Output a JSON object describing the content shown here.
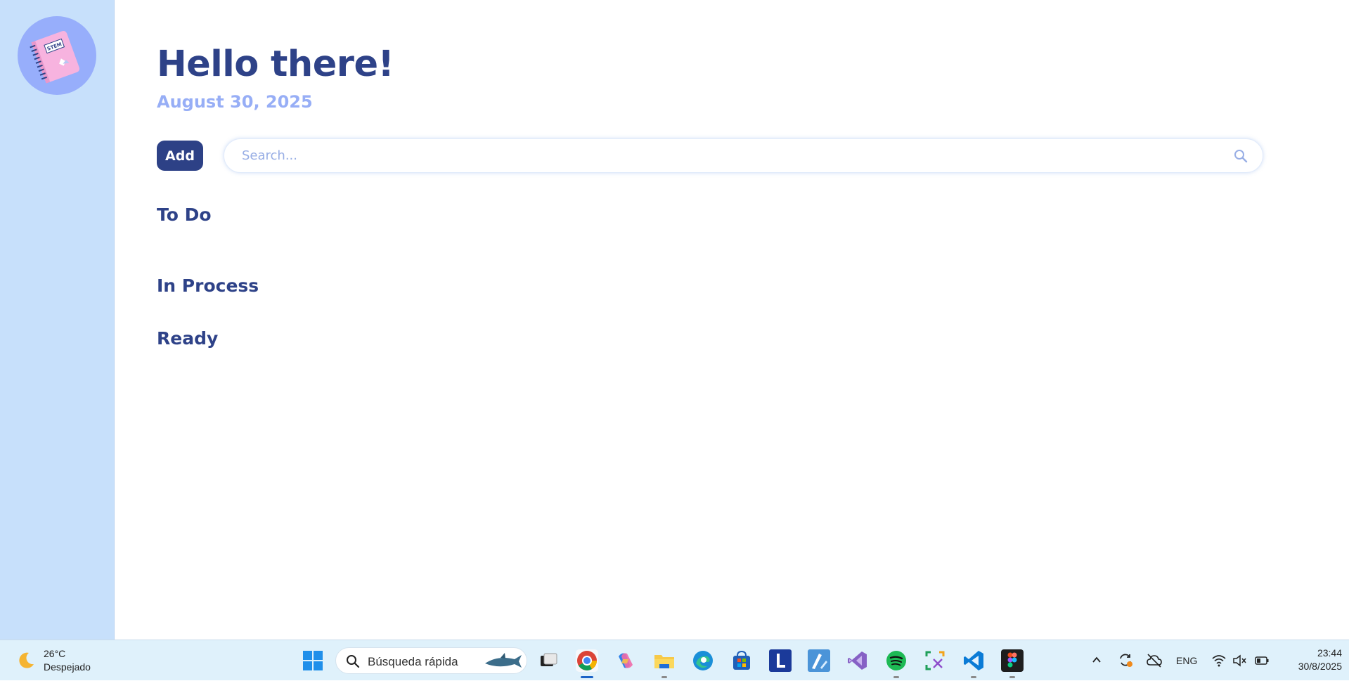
{
  "main": {
    "greeting": "Hello there!",
    "date": "August 30, 2025",
    "add_label": "Add",
    "search_placeholder": "Search...",
    "sections": [
      "To Do",
      "In Process",
      "Ready"
    ]
  },
  "logo": {
    "text": "STEM"
  },
  "taskbar": {
    "weather_temp": "26°C",
    "weather_desc": "Despejado",
    "search_label": "Búsqueda rápida",
    "language": "ENG",
    "time": "23:44",
    "date": "30/8/2025",
    "apps": [
      "start-icon",
      "task-view-icon",
      "chrome-icon",
      "copilot-icon",
      "file-explorer-icon",
      "edge-icon",
      "store-icon",
      "l-app-icon",
      "paint-icon",
      "visual-studio-icon",
      "spotify-icon",
      "snipping-tool-icon",
      "vscode-icon",
      "figma-icon"
    ]
  },
  "colors": {
    "sidebar": "#c7e0fb",
    "primary": "#2e4288",
    "accent": "#97aef6",
    "taskbar": "#dff1fb"
  }
}
